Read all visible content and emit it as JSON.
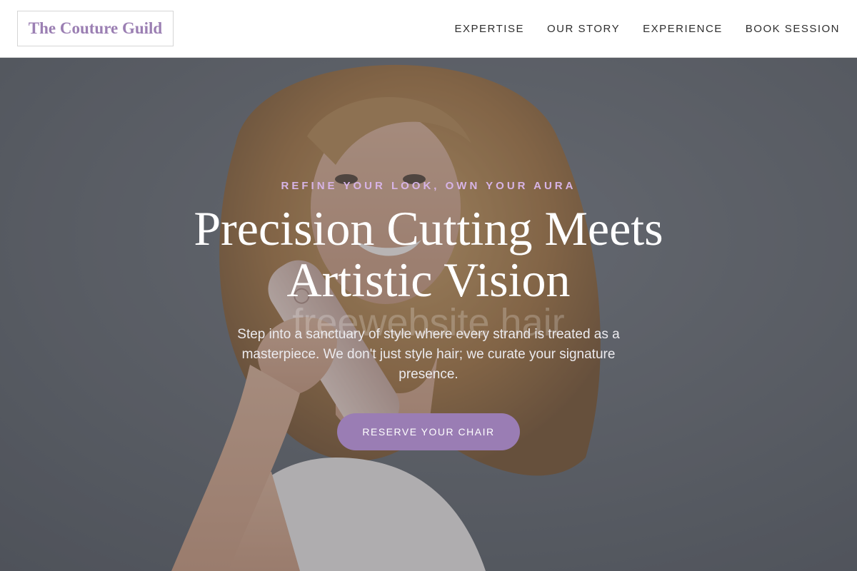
{
  "header": {
    "logo_text": "The Couture Guild",
    "nav": [
      {
        "label": "EXPERTISE"
      },
      {
        "label": "OUR STORY"
      },
      {
        "label": "EXPERIENCE"
      },
      {
        "label": "BOOK SESSION"
      }
    ]
  },
  "hero": {
    "eyebrow": "REFINE YOUR LOOK, OWN YOUR AURA",
    "headline_line1": "Precision Cutting Meets",
    "headline_line2": "Artistic Vision",
    "subtext": "Step into a sanctuary of style where every strand is treated as a masterpiece. We don't just style hair; we curate your signature presence.",
    "cta_label": "RESERVE YOUR CHAIR",
    "watermark": "freewebsite hair"
  },
  "colors": {
    "brand_purple": "#9b7fb3",
    "eyebrow_lavender": "#d7b4e6",
    "header_bg": "#ffffff",
    "hero_backdrop": "#676b73"
  }
}
